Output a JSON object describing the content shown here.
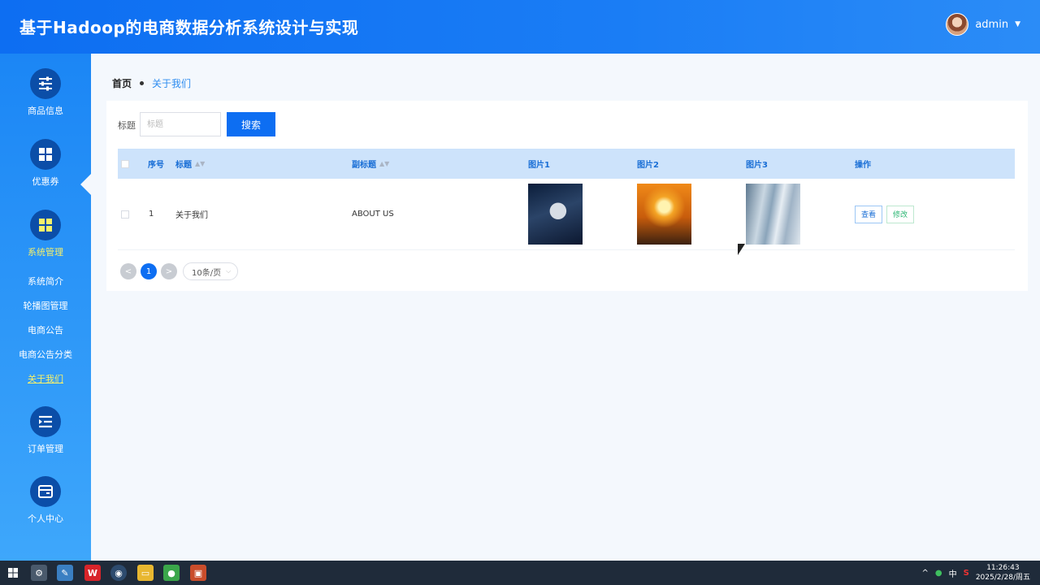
{
  "header": {
    "title": "基于Hadoop的电商数据分析系统设计与实现",
    "user_name": "admin"
  },
  "sidebar": {
    "groups": [
      {
        "label": "商品信息",
        "icon": "sliders-icon"
      },
      {
        "label": "优惠券",
        "icon": "grid-icon"
      },
      {
        "label": "系统管理",
        "icon": "grid-icon",
        "active": true
      },
      {
        "label": "订单管理",
        "icon": "list-indent-icon"
      },
      {
        "label": "个人中心",
        "icon": "wallet-icon"
      }
    ],
    "sub_items": [
      "系统简介",
      "轮播图管理",
      "电商公告",
      "电商公告分类",
      "关于我们"
    ],
    "active_sub": "关于我们"
  },
  "breadcrumb": {
    "home": "首页",
    "current": "关于我们"
  },
  "search": {
    "label": "标题",
    "placeholder": "标题",
    "button": "搜索"
  },
  "table": {
    "headers": {
      "index": "序号",
      "title": "标题",
      "subtitle": "副标题",
      "img1": "图片1",
      "img2": "图片2",
      "img3": "图片3",
      "ops": "操作"
    },
    "rows": [
      {
        "index": "1",
        "title": "关于我们",
        "subtitle": "ABOUT US",
        "view": "查看",
        "edit": "修改"
      }
    ]
  },
  "pagination": {
    "prev": "<",
    "page": "1",
    "next": ">",
    "page_size": "10条/页"
  },
  "taskbar": {
    "ime": "中",
    "time": "11:26:43",
    "date": "2025/2/28/周五"
  },
  "colors": {
    "primary": "#0d6ef2",
    "sidebar_active": "#f6f06a",
    "header_row": "#cde3fb"
  }
}
